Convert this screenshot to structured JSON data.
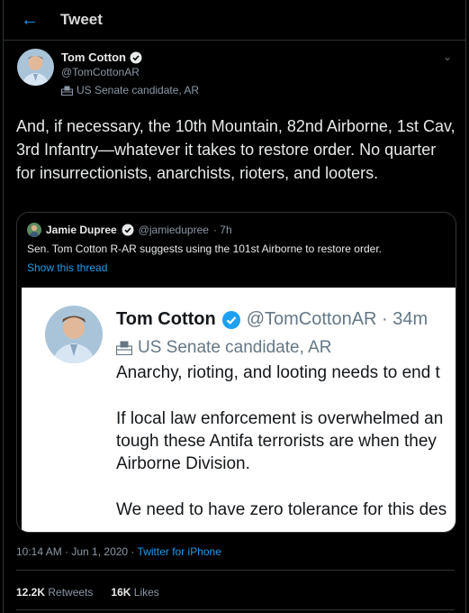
{
  "header": {
    "back_icon": "back-arrow-icon",
    "title": "Tweet"
  },
  "author": {
    "name": "Tom Cotton",
    "handle": "@TomCottonAR",
    "label": "US Senate candidate, AR"
  },
  "tweet_text": "And, if necessary, the 10th Mountain, 82nd Airborne, 1st Cav, 3rd Infantry—whatever it takes to restore order. No quarter for insurrectionists, anarchists, rioters, and looters.",
  "quote": {
    "name": "Jamie Dupree",
    "handle": "@jamiedupree",
    "time": "· 7h",
    "text": "Sen. Tom Cotton R-AR suggests using the 101st Airborne to restore order.",
    "show_thread": "Show this thread",
    "screenshot": {
      "name": "Tom Cotton",
      "handle_time": "@TomCottonAR · 34m",
      "label": "US Senate candidate, AR",
      "lines": [
        "Anarchy, rioting, and looting needs to end t",
        "If local law enforcement is overwhelmed an",
        "tough these Antifa terrorists are when they",
        "Airborne Division.",
        "We need to have zero tolerance for this des"
      ]
    }
  },
  "meta": {
    "time": "10:14 AM · Jun 1, 2020 · ",
    "source": "Twitter for iPhone"
  },
  "stats": {
    "retweets_count": "12.2K",
    "retweets_label": "Retweets",
    "likes_count": "16K",
    "likes_label": "Likes"
  },
  "colors": {
    "accent": "#1d9bf0",
    "background": "#000000",
    "border": "#2f3336"
  }
}
